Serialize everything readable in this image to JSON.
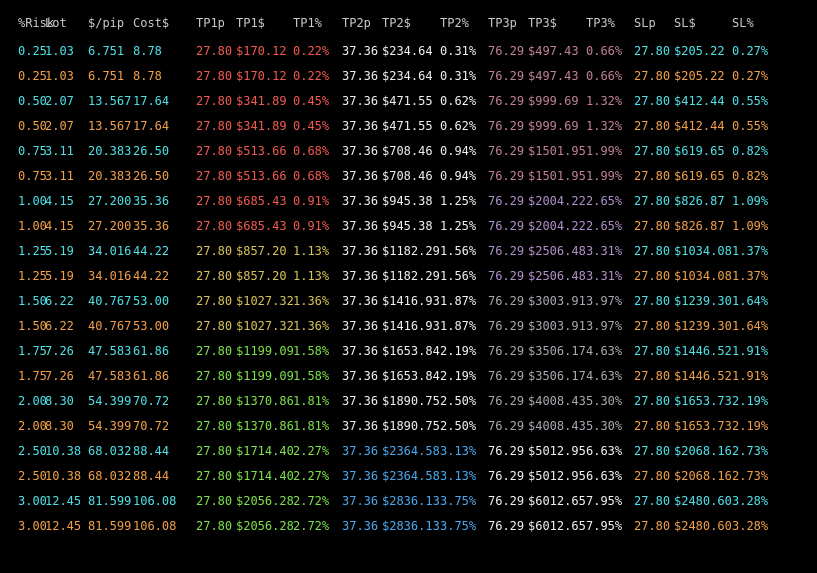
{
  "headers": [
    "%Risk",
    "Lot",
    "$/pip",
    "Cost$",
    "TP1p",
    "TP1$",
    "TP1%",
    "TP2p",
    "TP2$",
    "TP2%",
    "TP3p",
    "TP3$",
    "TP3%",
    "SLp",
    "SL$",
    "SL%"
  ],
  "colors": {
    "background": "#000000",
    "header": "#c8c8c8",
    "cyan": "#4fe0e6",
    "orange": "#f0a04a",
    "red": "#f05a50",
    "yellow": "#d8c25a",
    "green": "#7ee04a",
    "white": "#f0f0f0",
    "blue": "#4aa8f0",
    "magenta": "#c0809a",
    "purple": "#b090c8",
    "gray": "#a8a8b0"
  },
  "rows": [
    {
      "risk": "0.25",
      "lot": "1.03",
      "pip": "6.751",
      "cost": "8.78",
      "tp1p": "27.80",
      "tp1d": "$170.12",
      "tp1pct": "0.22%",
      "tp2p": "37.36",
      "tp2d": "$234.64",
      "tp2pct": "0.31%",
      "tp3p": "76.29",
      "tp3d": "$497.43",
      "tp3pct": "0.66%",
      "slp": "27.80",
      "sld": "$205.22",
      "slpct": "0.27%"
    },
    {
      "risk": "0.25",
      "lot": "1.03",
      "pip": "6.751",
      "cost": "8.78",
      "tp1p": "27.80",
      "tp1d": "$170.12",
      "tp1pct": "0.22%",
      "tp2p": "37.36",
      "tp2d": "$234.64",
      "tp2pct": "0.31%",
      "tp3p": "76.29",
      "tp3d": "$497.43",
      "tp3pct": "0.66%",
      "slp": "27.80",
      "sld": "$205.22",
      "slpct": "0.27%"
    },
    {
      "risk": "0.50",
      "lot": "2.07",
      "pip": "13.567",
      "cost": "17.64",
      "tp1p": "27.80",
      "tp1d": "$341.89",
      "tp1pct": "0.45%",
      "tp2p": "37.36",
      "tp2d": "$471.55",
      "tp2pct": "0.62%",
      "tp3p": "76.29",
      "tp3d": "$999.69",
      "tp3pct": "1.32%",
      "slp": "27.80",
      "sld": "$412.44",
      "slpct": "0.55%"
    },
    {
      "risk": "0.50",
      "lot": "2.07",
      "pip": "13.567",
      "cost": "17.64",
      "tp1p": "27.80",
      "tp1d": "$341.89",
      "tp1pct": "0.45%",
      "tp2p": "37.36",
      "tp2d": "$471.55",
      "tp2pct": "0.62%",
      "tp3p": "76.29",
      "tp3d": "$999.69",
      "tp3pct": "1.32%",
      "slp": "27.80",
      "sld": "$412.44",
      "slpct": "0.55%"
    },
    {
      "risk": "0.75",
      "lot": "3.11",
      "pip": "20.383",
      "cost": "26.50",
      "tp1p": "27.80",
      "tp1d": "$513.66",
      "tp1pct": "0.68%",
      "tp2p": "37.36",
      "tp2d": "$708.46",
      "tp2pct": "0.94%",
      "tp3p": "76.29",
      "tp3d": "$1501.95",
      "tp3pct": "1.99%",
      "slp": "27.80",
      "sld": "$619.65",
      "slpct": "0.82%"
    },
    {
      "risk": "0.75",
      "lot": "3.11",
      "pip": "20.383",
      "cost": "26.50",
      "tp1p": "27.80",
      "tp1d": "$513.66",
      "tp1pct": "0.68%",
      "tp2p": "37.36",
      "tp2d": "$708.46",
      "tp2pct": "0.94%",
      "tp3p": "76.29",
      "tp3d": "$1501.95",
      "tp3pct": "1.99%",
      "slp": "27.80",
      "sld": "$619.65",
      "slpct": "0.82%"
    },
    {
      "risk": "1.00",
      "lot": "4.15",
      "pip": "27.200",
      "cost": "35.36",
      "tp1p": "27.80",
      "tp1d": "$685.43",
      "tp1pct": "0.91%",
      "tp2p": "37.36",
      "tp2d": "$945.38",
      "tp2pct": "1.25%",
      "tp3p": "76.29",
      "tp3d": "$2004.22",
      "tp3pct": "2.65%",
      "slp": "27.80",
      "sld": "$826.87",
      "slpct": "1.09%"
    },
    {
      "risk": "1.00",
      "lot": "4.15",
      "pip": "27.200",
      "cost": "35.36",
      "tp1p": "27.80",
      "tp1d": "$685.43",
      "tp1pct": "0.91%",
      "tp2p": "37.36",
      "tp2d": "$945.38",
      "tp2pct": "1.25%",
      "tp3p": "76.29",
      "tp3d": "$2004.22",
      "tp3pct": "2.65%",
      "slp": "27.80",
      "sld": "$826.87",
      "slpct": "1.09%"
    },
    {
      "risk": "1.25",
      "lot": "5.19",
      "pip": "34.016",
      "cost": "44.22",
      "tp1p": "27.80",
      "tp1d": "$857.20",
      "tp1pct": "1.13%",
      "tp2p": "37.36",
      "tp2d": "$1182.29",
      "tp2pct": "1.56%",
      "tp3p": "76.29",
      "tp3d": "$2506.48",
      "tp3pct": "3.31%",
      "slp": "27.80",
      "sld": "$1034.08",
      "slpct": "1.37%"
    },
    {
      "risk": "1.25",
      "lot": "5.19",
      "pip": "34.016",
      "cost": "44.22",
      "tp1p": "27.80",
      "tp1d": "$857.20",
      "tp1pct": "1.13%",
      "tp2p": "37.36",
      "tp2d": "$1182.29",
      "tp2pct": "1.56%",
      "tp3p": "76.29",
      "tp3d": "$2506.48",
      "tp3pct": "3.31%",
      "slp": "27.80",
      "sld": "$1034.08",
      "slpct": "1.37%"
    },
    {
      "risk": "1.50",
      "lot": "6.22",
      "pip": "40.767",
      "cost": "53.00",
      "tp1p": "27.80",
      "tp1d": "$1027.32",
      "tp1pct": "1.36%",
      "tp2p": "37.36",
      "tp2d": "$1416.93",
      "tp2pct": "1.87%",
      "tp3p": "76.29",
      "tp3d": "$3003.91",
      "tp3pct": "3.97%",
      "slp": "27.80",
      "sld": "$1239.30",
      "slpct": "1.64%"
    },
    {
      "risk": "1.50",
      "lot": "6.22",
      "pip": "40.767",
      "cost": "53.00",
      "tp1p": "27.80",
      "tp1d": "$1027.32",
      "tp1pct": "1.36%",
      "tp2p": "37.36",
      "tp2d": "$1416.93",
      "tp2pct": "1.87%",
      "tp3p": "76.29",
      "tp3d": "$3003.91",
      "tp3pct": "3.97%",
      "slp": "27.80",
      "sld": "$1239.30",
      "slpct": "1.64%"
    },
    {
      "risk": "1.75",
      "lot": "7.26",
      "pip": "47.583",
      "cost": "61.86",
      "tp1p": "27.80",
      "tp1d": "$1199.09",
      "tp1pct": "1.58%",
      "tp2p": "37.36",
      "tp2d": "$1653.84",
      "tp2pct": "2.19%",
      "tp3p": "76.29",
      "tp3d": "$3506.17",
      "tp3pct": "4.63%",
      "slp": "27.80",
      "sld": "$1446.52",
      "slpct": "1.91%"
    },
    {
      "risk": "1.75",
      "lot": "7.26",
      "pip": "47.583",
      "cost": "61.86",
      "tp1p": "27.80",
      "tp1d": "$1199.09",
      "tp1pct": "1.58%",
      "tp2p": "37.36",
      "tp2d": "$1653.84",
      "tp2pct": "2.19%",
      "tp3p": "76.29",
      "tp3d": "$3506.17",
      "tp3pct": "4.63%",
      "slp": "27.80",
      "sld": "$1446.52",
      "slpct": "1.91%"
    },
    {
      "risk": "2.00",
      "lot": "8.30",
      "pip": "54.399",
      "cost": "70.72",
      "tp1p": "27.80",
      "tp1d": "$1370.86",
      "tp1pct": "1.81%",
      "tp2p": "37.36",
      "tp2d": "$1890.75",
      "tp2pct": "2.50%",
      "tp3p": "76.29",
      "tp3d": "$4008.43",
      "tp3pct": "5.30%",
      "slp": "27.80",
      "sld": "$1653.73",
      "slpct": "2.19%"
    },
    {
      "risk": "2.00",
      "lot": "8.30",
      "pip": "54.399",
      "cost": "70.72",
      "tp1p": "27.80",
      "tp1d": "$1370.86",
      "tp1pct": "1.81%",
      "tp2p": "37.36",
      "tp2d": "$1890.75",
      "tp2pct": "2.50%",
      "tp3p": "76.29",
      "tp3d": "$4008.43",
      "tp3pct": "5.30%",
      "slp": "27.80",
      "sld": "$1653.73",
      "slpct": "2.19%"
    },
    {
      "risk": "2.50",
      "lot": "10.38",
      "pip": "68.032",
      "cost": "88.44",
      "tp1p": "27.80",
      "tp1d": "$1714.40",
      "tp1pct": "2.27%",
      "tp2p": "37.36",
      "tp2d": "$2364.58",
      "tp2pct": "3.13%",
      "tp3p": "76.29",
      "tp3d": "$5012.95",
      "tp3pct": "6.63%",
      "slp": "27.80",
      "sld": "$2068.16",
      "slpct": "2.73%"
    },
    {
      "risk": "2.50",
      "lot": "10.38",
      "pip": "68.032",
      "cost": "88.44",
      "tp1p": "27.80",
      "tp1d": "$1714.40",
      "tp1pct": "2.27%",
      "tp2p": "37.36",
      "tp2d": "$2364.58",
      "tp2pct": "3.13%",
      "tp3p": "76.29",
      "tp3d": "$5012.95",
      "tp3pct": "6.63%",
      "slp": "27.80",
      "sld": "$2068.16",
      "slpct": "2.73%"
    },
    {
      "risk": "3.00",
      "lot": "12.45",
      "pip": "81.599",
      "cost": "106.08",
      "tp1p": "27.80",
      "tp1d": "$2056.28",
      "tp1pct": "2.72%",
      "tp2p": "37.36",
      "tp2d": "$2836.13",
      "tp2pct": "3.75%",
      "tp3p": "76.29",
      "tp3d": "$6012.65",
      "tp3pct": "7.95%",
      "slp": "27.80",
      "sld": "$2480.60",
      "slpct": "3.28%"
    },
    {
      "risk": "3.00",
      "lot": "12.45",
      "pip": "81.599",
      "cost": "106.08",
      "tp1p": "27.80",
      "tp1d": "$2056.28",
      "tp1pct": "2.72%",
      "tp2p": "37.36",
      "tp2d": "$2836.13",
      "tp2pct": "3.75%",
      "tp3p": "76.29",
      "tp3d": "$6012.65",
      "tp3pct": "7.95%",
      "slp": "27.80",
      "sld": "$2480.60",
      "slpct": "3.28%"
    }
  ],
  "row_colors": [
    {
      "base": "cyan",
      "tp1": "red",
      "tp2": "white",
      "tp3": "magenta",
      "sl": "cyan"
    },
    {
      "base": "orange",
      "tp1": "red",
      "tp2": "white",
      "tp3": "magenta",
      "sl": "orange"
    },
    {
      "base": "cyan",
      "tp1": "red",
      "tp2": "white",
      "tp3": "magenta",
      "sl": "cyan"
    },
    {
      "base": "orange",
      "tp1": "red",
      "tp2": "white",
      "tp3": "magenta",
      "sl": "orange"
    },
    {
      "base": "cyan",
      "tp1": "red",
      "tp2": "white",
      "tp3": "magenta",
      "sl": "cyan"
    },
    {
      "base": "orange",
      "tp1": "red",
      "tp2": "white",
      "tp3": "magenta",
      "sl": "orange"
    },
    {
      "base": "cyan",
      "tp1": "red",
      "tp2": "white",
      "tp3": "purple",
      "sl": "cyan"
    },
    {
      "base": "orange",
      "tp1": "red",
      "tp2": "white",
      "tp3": "purple",
      "sl": "orange"
    },
    {
      "base": "cyan",
      "tp1": "yellow",
      "tp2": "white",
      "tp3": "purple",
      "sl": "cyan"
    },
    {
      "base": "orange",
      "tp1": "yellow",
      "tp2": "white",
      "tp3": "purple",
      "sl": "orange"
    },
    {
      "base": "cyan",
      "tp1": "yellow",
      "tp2": "white",
      "tp3": "gray",
      "sl": "cyan"
    },
    {
      "base": "orange",
      "tp1": "yellow",
      "tp2": "white",
      "tp3": "gray",
      "sl": "orange"
    },
    {
      "base": "cyan",
      "tp1": "green",
      "tp2": "white",
      "tp3": "gray",
      "sl": "cyan"
    },
    {
      "base": "orange",
      "tp1": "green",
      "tp2": "white",
      "tp3": "gray",
      "sl": "orange"
    },
    {
      "base": "cyan",
      "tp1": "green",
      "tp2": "white",
      "tp3": "gray",
      "sl": "cyan"
    },
    {
      "base": "orange",
      "tp1": "green",
      "tp2": "white",
      "tp3": "gray",
      "sl": "orange"
    },
    {
      "base": "cyan",
      "tp1": "green",
      "tp2": "blue",
      "tp3": "white",
      "sl": "cyan"
    },
    {
      "base": "orange",
      "tp1": "green",
      "tp2": "blue",
      "tp3": "white",
      "sl": "orange"
    },
    {
      "base": "cyan",
      "tp1": "green",
      "tp2": "blue",
      "tp3": "white",
      "sl": "cyan"
    },
    {
      "base": "orange",
      "tp1": "green",
      "tp2": "blue",
      "tp3": "white",
      "sl": "orange"
    }
  ]
}
